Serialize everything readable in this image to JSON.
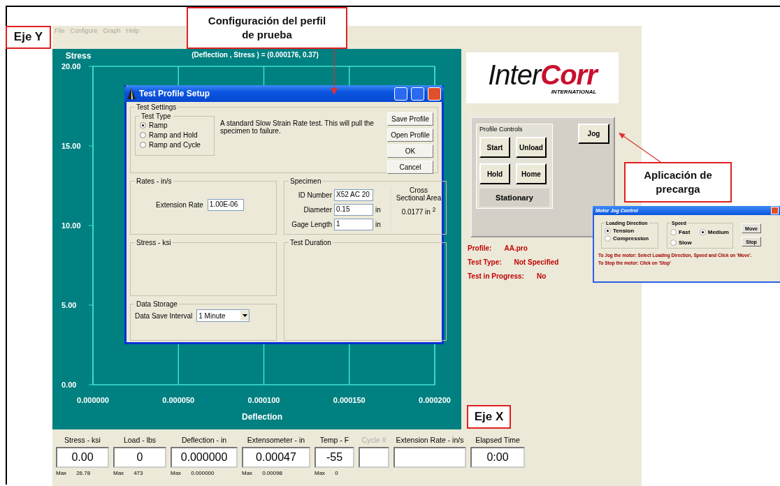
{
  "annotations": [
    {
      "text": "Eje Y"
    },
    {
      "text": "Configuración  del perfil de prueba"
    },
    {
      "text": "Aplicación de precarga"
    },
    {
      "text": "Eje X"
    }
  ],
  "menu": [
    {
      "label": "File",
      "disabled": true
    },
    {
      "label": "Configure",
      "disabled": true
    },
    {
      "label": "Graph",
      "disabled": true
    },
    {
      "label": "Help",
      "disabled": true
    }
  ],
  "chart": {
    "cursor_readout": "(Deflection , Stress ) = (0.000176, 0.37)",
    "chart_data": {
      "type": "line",
      "grid": true,
      "xlabel": "Deflection",
      "ylabel": "Stress",
      "xlim": [
        0,
        0.0002
      ],
      "ylim": [
        0,
        20
      ],
      "xticks": [
        {
          "value": 0,
          "label": "0.000000"
        },
        {
          "value": 5e-05,
          "label": "0.000050"
        },
        {
          "value": 0.0001,
          "label": "0.000100"
        },
        {
          "value": 0.00015,
          "label": "0.000150"
        },
        {
          "value": 0.0002,
          "label": "0.000200"
        }
      ],
      "yticks": [
        {
          "value": 0,
          "label": "0.00"
        },
        {
          "value": 5,
          "label": "5.00"
        },
        {
          "value": 10,
          "label": "10.00"
        },
        {
          "value": 15,
          "label": "15.00"
        },
        {
          "value": 20,
          "label": "20.00"
        }
      ]
    }
  },
  "logo": {
    "wordmark": "Inter**Corr**",
    "tagline": "INTERNATIONAL"
  },
  "profile_controls": {
    "title": "Profile Controls",
    "buttons": [
      "Start",
      "Unload",
      "Hold",
      "Home"
    ],
    "state": "Stationary"
  },
  "jog_button": "Jog",
  "status": [
    {
      "label": "Profile:",
      "value": "AA.pro"
    },
    {
      "label": "Test Type:",
      "value": "Not Specified"
    },
    {
      "label": "Test in Progress:",
      "value": "No"
    }
  ],
  "readouts": [
    {
      "label": "Stress - ksi",
      "value": "0.00",
      "max_label": "Max",
      "max": "26.78",
      "disabled": false
    },
    {
      "label": "Load - lbs",
      "value": "0",
      "max_label": "Max",
      "max": "473",
      "disabled": false
    },
    {
      "label": "Deflection - in",
      "value": "0.000000",
      "max_label": "Max",
      "max": "0.000000",
      "disabled": false
    },
    {
      "label": "Extensometer - in",
      "value": "0.00047",
      "max_label": "Max",
      "max": "0.00098",
      "disabled": false
    },
    {
      "label": "Temp - F",
      "value": "-55",
      "max_label": "Max",
      "max": "0",
      "disabled": false
    },
    {
      "label": "Cycle #",
      "disabled": true
    },
    {
      "label": "Extension Rate - in/s",
      "disabled": false
    },
    {
      "label": "Elapsed Time",
      "value": "0:00",
      "disabled": false
    }
  ],
  "dialog": {
    "title": "Test Profile Setup",
    "test_settings": {
      "title": "Test Settings",
      "test_type_title": "Test Type",
      "test_types": [
        {
          "label": "Ramp",
          "selected": true
        },
        {
          "label": "Ramp and Hold",
          "selected": false
        },
        {
          "label": "Ramp and Cycle",
          "selected": false
        }
      ],
      "description": "A standard Slow Strain Rate test.  This will pull the specimen to failure.",
      "buttons": [
        "Save Profile",
        "Open Profile",
        "OK",
        "Cancel"
      ]
    },
    "rates": {
      "title": "Rates - in/s",
      "label": "Extension Rate",
      "value": "1.00E-06"
    },
    "specimen": {
      "title": "Specimen",
      "fields": [
        {
          "label": "ID Number",
          "value": "X52 AC 20"
        },
        {
          "label": "Diameter",
          "value": "0.15",
          "unit": "in"
        },
        {
          "label": "Gage Length",
          "value": "1",
          "unit": "in"
        }
      ],
      "area_label": "Cross Sectional Area",
      "area_value": "0.0177 in  $^{2}$"
    },
    "stress": {
      "title": "Stress - ksi"
    },
    "duration": {
      "title": "Test Duration"
    },
    "storage": {
      "title": "Data Storage",
      "label": "Data Save Interval",
      "value": "1 Minute"
    }
  },
  "jog_window": {
    "title": "Motor Jog Control",
    "direction_title": "Loading Direction",
    "directions": [
      {
        "label": "Tension",
        "selected": true
      },
      {
        "label": "Compression",
        "selected": false
      }
    ],
    "speed_title": "Speed",
    "speeds": [
      {
        "label": "Fast",
        "selected": false
      },
      {
        "label": "Medium",
        "selected": true
      },
      {
        "label": "Slow",
        "selected": false
      }
    ],
    "buttons": [
      "Move",
      "Stop"
    ],
    "help": [
      "To Jog the motor: Select Loading Direction, Speed and Click on 'Move'.",
      "To Stop the motor: Click on 'Stop'"
    ]
  }
}
